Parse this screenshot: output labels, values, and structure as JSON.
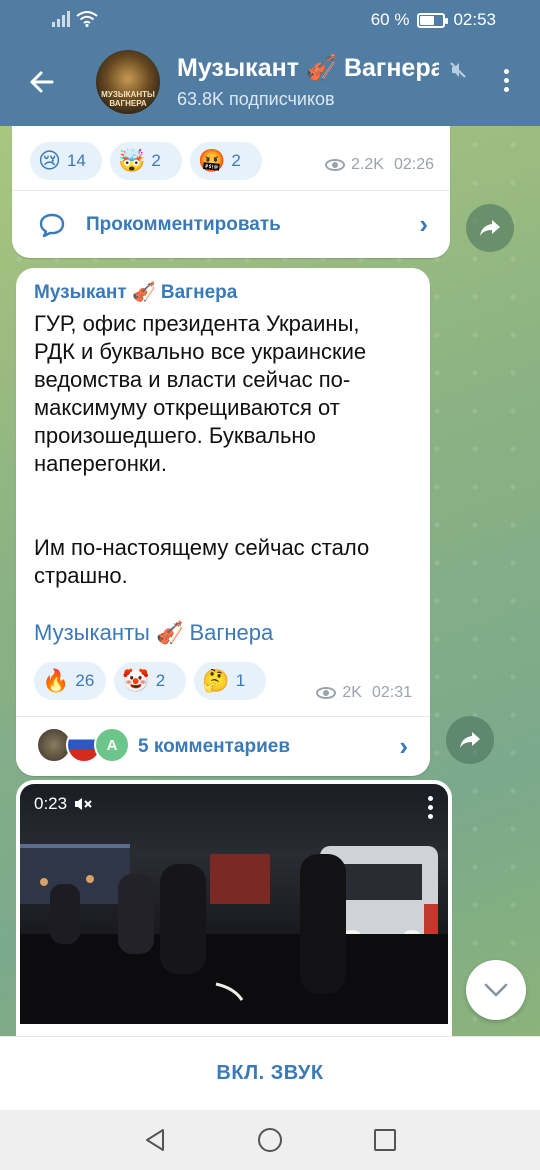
{
  "status_bar": {
    "battery": "60 %",
    "battery_level": 0.6,
    "time": "02:53"
  },
  "header": {
    "avatar_text": "МУЗЫКАНТЫ ВАГНЕРА",
    "title": "Музыкант 🎻 Вагнера",
    "subscribers": "63.8K подписчиков"
  },
  "post1": {
    "reactions": [
      {
        "emoji": "😢",
        "count": "14"
      },
      {
        "emoji": "🤯",
        "count": "2"
      },
      {
        "emoji": "🤬",
        "count": "2"
      }
    ],
    "views": "2.2K",
    "time": "02:26",
    "comment_label": "Прокомментировать"
  },
  "post2": {
    "author": "Музыкант 🎻 Вагнера",
    "text": "ГУР, офис президента Украины, РДК и буквально все украинские ведомства и власти сейчас по-максимуму открещиваются от произошедшего. Буквально наперегонки.\n\n\nИм по-настоящему сейчас стало страшно.",
    "signature": "Музыканты 🎻 Вагнера",
    "reactions": [
      {
        "emoji": "🔥",
        "count": "26"
      },
      {
        "emoji": "🤡",
        "count": "2"
      },
      {
        "emoji": "🤔",
        "count": "1"
      }
    ],
    "views": "2K",
    "time": "02:31",
    "commenter_initial": "A",
    "comments_label": "5 комментариев"
  },
  "video": {
    "time": "0:23"
  },
  "bottom_bar": {
    "label": "ВКЛ. ЗВУК"
  },
  "colors": {
    "header": "#527da3",
    "accent": "#3a7ab8"
  }
}
